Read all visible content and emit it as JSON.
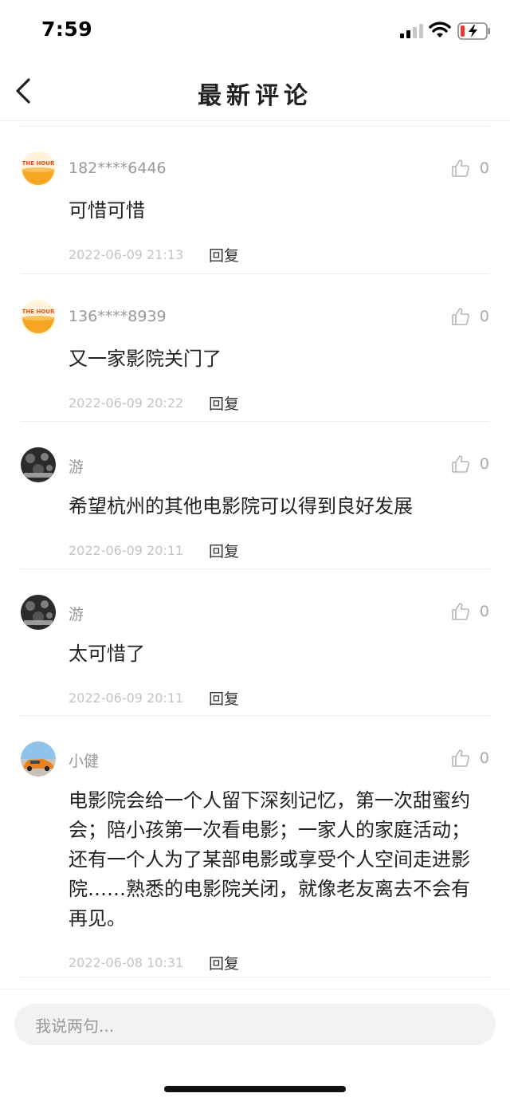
{
  "status_bar": {
    "time": "7:59"
  },
  "header": {
    "title": "最新评论"
  },
  "comments": [
    {
      "username": "182****6446",
      "avatar": "the-hour-logo",
      "content": "可惜可惜",
      "time": "2022-06-09 21:13",
      "reply_label": "回复",
      "likes": "0"
    },
    {
      "username": "136****8939",
      "avatar": "the-hour-logo",
      "content": "又一家影院关门了",
      "time": "2022-06-09 20:22",
      "reply_label": "回复",
      "likes": "0"
    },
    {
      "username": "游",
      "avatar": "dark-photo",
      "content": "希望杭州的其他电影院可以得到良好发展",
      "time": "2022-06-09 20:11",
      "reply_label": "回复",
      "likes": "0"
    },
    {
      "username": "游",
      "avatar": "dark-photo",
      "content": "太可惜了",
      "time": "2022-06-09 20:11",
      "reply_label": "回复",
      "likes": "0"
    },
    {
      "username": "小健",
      "avatar": "car-photo",
      "content": "电影院会给一个人留下深刻记忆，第一次甜蜜约会；陪小孩第一次看电影；一家人的家庭活动；还有一个人为了某部电影或享受个人空间走进影院……熟悉的电影院关闭，就像老友离去不会有再见。",
      "time": "2022-06-08 10:31",
      "reply_label": "回复",
      "likes": "0"
    }
  ],
  "input": {
    "placeholder": "我说两句..."
  },
  "colors": {
    "text": "#222222",
    "muted": "#999999",
    "timestamp": "#c4c4c4",
    "divider": "#eeeeee",
    "input_bg": "#f2f2f2",
    "avatar_orange": "#f5a623",
    "battery_red": "#e53935"
  }
}
